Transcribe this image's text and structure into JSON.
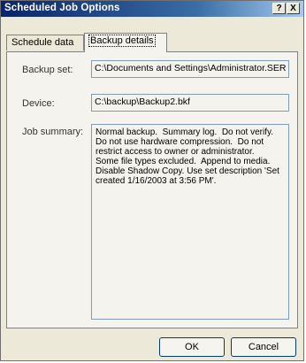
{
  "window": {
    "title": "Scheduled Job Options",
    "help_btn": "?",
    "close_btn": "X"
  },
  "tabs": [
    {
      "label": "Schedule data"
    },
    {
      "label": "Backup details"
    }
  ],
  "backup": {
    "set_label": "Backup set:",
    "set_value": "C:\\Documents and Settings\\Administrator.SER",
    "device_label": "Device:",
    "device_value": "C:\\backup\\Backup2.bkf",
    "summary_label": "Job summary:",
    "summary_value": "Normal backup.  Summary log.  Do not verify.\nDo not use hardware compression.  Do not\nrestrict access to owner or administrator.\nSome file types excluded.  Append to media.\nDisable Shadow Copy. Use set description 'Set\ncreated 1/16/2003 at 3:56 PM'."
  },
  "buttons": {
    "ok": "OK",
    "cancel": "Cancel"
  }
}
